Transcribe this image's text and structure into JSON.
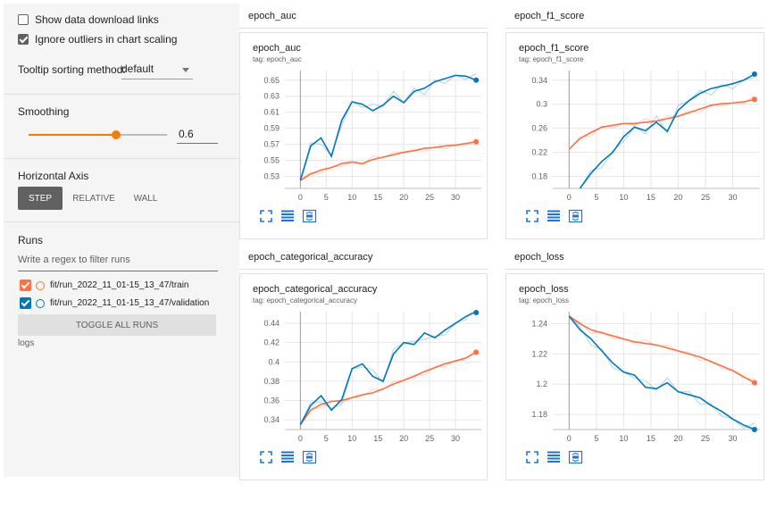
{
  "sidebar": {
    "show_download_label": "Show data download links",
    "ignore_outliers_label": "Ignore outliers in chart scaling",
    "tooltip_label": "Tooltip sorting method:",
    "tooltip_value": "default",
    "smoothing_label": "Smoothing",
    "smoothing_value": "0.6",
    "smoothing_fraction": 0.6,
    "horizontal_axis_label": "Horizontal Axis",
    "axis_options": [
      "STEP",
      "RELATIVE",
      "WALL"
    ],
    "runs_label": "Runs",
    "filter_placeholder": "Write a regex to filter runs",
    "runs": [
      {
        "name": "fit/run_2022_11_01-15_13_47/train",
        "color": "#ff7043"
      },
      {
        "name": "fit/run_2022_11_01-15_13_47/validation",
        "color": "#0077bb"
      }
    ],
    "toggle_all_label": "TOGGLE ALL RUNS",
    "logs_label": "logs"
  },
  "colors": {
    "train": "#ff7043",
    "validation": "#0077bb",
    "accent": "#f57c00"
  },
  "icons": [
    "fullscreen-icon",
    "log-scale-icon",
    "fit-domain-icon"
  ],
  "charts": [
    {
      "header": "epoch_auc",
      "title": "epoch_auc",
      "tag": "tag: epoch_auc",
      "chart_data": {
        "type": "line",
        "xticks": [
          0,
          5,
          10,
          15,
          20,
          25,
          30
        ],
        "yticks": [
          0.53,
          0.55,
          0.57,
          0.59,
          0.61,
          0.63,
          0.65
        ],
        "ylim": [
          0.515,
          0.662
        ],
        "xlim": [
          -3,
          35
        ],
        "series": [
          {
            "name": "fit/run_2022_11_01-15_13_47/train",
            "x": [
              0,
              2,
              4,
              6,
              8,
              10,
              12,
              14,
              16,
              18,
              20,
              22,
              24,
              26,
              28,
              30,
              32,
              34
            ],
            "y": [
              0.525,
              0.533,
              0.538,
              0.541,
              0.546,
              0.548,
              0.546,
              0.551,
              0.554,
              0.557,
              0.56,
              0.562,
              0.565,
              0.566,
              0.568,
              0.569,
              0.571,
              0.573
            ]
          },
          {
            "name": "fit/run_2022_11_01-15_13_47/validation",
            "x": [
              0,
              2,
              4,
              6,
              8,
              10,
              12,
              14,
              16,
              18,
              20,
              22,
              24,
              26,
              28,
              30,
              32,
              34
            ],
            "y": [
              0.525,
              0.568,
              0.578,
              0.555,
              0.6,
              0.623,
              0.62,
              0.612,
              0.619,
              0.63,
              0.622,
              0.636,
              0.64,
              0.648,
              0.652,
              0.656,
              0.655,
              0.65
            ]
          }
        ]
      }
    },
    {
      "header": "epoch_f1_score",
      "title": "epoch_f1_score",
      "tag": "tag: epoch_f1_score",
      "chart_data": {
        "type": "line",
        "xticks": [
          0,
          5,
          10,
          15,
          20,
          25,
          30
        ],
        "yticks": [
          0.18,
          0.22,
          0.26,
          0.3,
          0.34
        ],
        "ylim": [
          0.16,
          0.356
        ],
        "xlim": [
          -3,
          35
        ],
        "series": [
          {
            "name": "fit/run_2022_11_01-15_13_47/train",
            "x": [
              0,
              2,
              4,
              6,
              8,
              10,
              12,
              14,
              16,
              18,
              20,
              22,
              24,
              26,
              28,
              30,
              32,
              34
            ],
            "y": [
              0.225,
              0.243,
              0.253,
              0.262,
              0.265,
              0.268,
              0.268,
              0.27,
              0.272,
              0.276,
              0.28,
              0.286,
              0.292,
              0.298,
              0.301,
              0.302,
              0.304,
              0.308
            ]
          },
          {
            "name": "fit/run_2022_11_01-15_13_47/validation",
            "x": [
              2,
              4,
              6,
              8,
              10,
              12,
              14,
              16,
              18,
              20,
              22,
              24,
              26,
              28,
              30,
              32,
              34
            ],
            "y": [
              0.16,
              0.185,
              0.205,
              0.22,
              0.246,
              0.262,
              0.256,
              0.27,
              0.255,
              0.29,
              0.306,
              0.318,
              0.326,
              0.33,
              0.334,
              0.34,
              0.35
            ]
          }
        ]
      }
    },
    {
      "header": "epoch_categorical_accuracy",
      "title": "epoch_categorical_accuracy",
      "tag": "tag: epoch_categorical_accuracy",
      "chart_data": {
        "type": "line",
        "xticks": [
          0,
          5,
          10,
          15,
          20,
          25,
          30
        ],
        "yticks": [
          0.34,
          0.36,
          0.38,
          0.4,
          0.42,
          0.44
        ],
        "ylim": [
          0.33,
          0.452
        ],
        "xlim": [
          -3,
          35
        ],
        "series": [
          {
            "name": "fit/run_2022_11_01-15_13_47/train",
            "x": [
              0,
              2,
              4,
              6,
              8,
              10,
              12,
              14,
              16,
              18,
              20,
              22,
              24,
              26,
              28,
              30,
              32,
              34
            ],
            "y": [
              0.335,
              0.35,
              0.356,
              0.359,
              0.36,
              0.363,
              0.366,
              0.368,
              0.372,
              0.377,
              0.381,
              0.385,
              0.39,
              0.394,
              0.398,
              0.401,
              0.404,
              0.41
            ]
          },
          {
            "name": "fit/run_2022_11_01-15_13_47/validation",
            "x": [
              0,
              2,
              4,
              6,
              8,
              10,
              12,
              14,
              16,
              18,
              20,
              22,
              24,
              26,
              28,
              30,
              32,
              34
            ],
            "y": [
              0.335,
              0.355,
              0.365,
              0.35,
              0.361,
              0.393,
              0.398,
              0.385,
              0.38,
              0.408,
              0.42,
              0.418,
              0.43,
              0.425,
              0.433,
              0.44,
              0.447,
              0.452
            ]
          }
        ]
      }
    },
    {
      "header": "epoch_loss",
      "title": "epoch_loss",
      "tag": "tag: epoch_loss",
      "chart_data": {
        "type": "line",
        "xticks": [
          0,
          5,
          10,
          15,
          20,
          25,
          30
        ],
        "yticks": [
          1.18,
          1.2,
          1.22,
          1.24
        ],
        "ylim": [
          1.17,
          1.248
        ],
        "xlim": [
          -3,
          35
        ],
        "series": [
          {
            "name": "fit/run_2022_11_01-15_13_47/train",
            "x": [
              0,
              2,
              4,
              6,
              8,
              10,
              12,
              14,
              16,
              18,
              20,
              22,
              24,
              26,
              28,
              30,
              32,
              34
            ],
            "y": [
              1.245,
              1.24,
              1.236,
              1.234,
              1.232,
              1.23,
              1.228,
              1.227,
              1.226,
              1.224,
              1.222,
              1.22,
              1.218,
              1.215,
              1.212,
              1.209,
              1.205,
              1.201
            ]
          },
          {
            "name": "fit/run_2022_11_01-15_13_47/validation",
            "x": [
              0,
              2,
              4,
              6,
              8,
              10,
              12,
              14,
              16,
              18,
              20,
              22,
              24,
              26,
              28,
              30,
              32,
              34
            ],
            "y": [
              1.245,
              1.236,
              1.23,
              1.222,
              1.214,
              1.208,
              1.206,
              1.198,
              1.197,
              1.201,
              1.195,
              1.193,
              1.191,
              1.186,
              1.182,
              1.177,
              1.173,
              1.17
            ]
          }
        ]
      }
    }
  ]
}
